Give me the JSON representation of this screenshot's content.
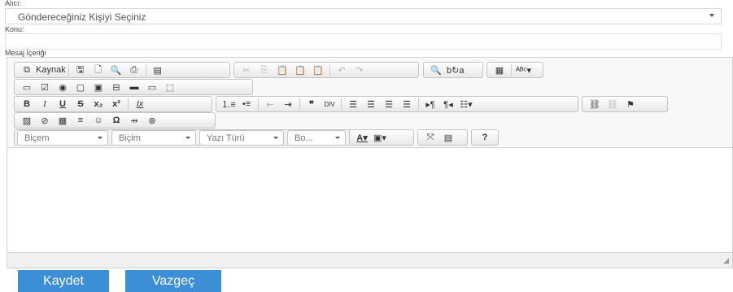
{
  "recipient": {
    "label": "Alıcı:",
    "placeholder": "Göndereceğiniz Kişiyi Seçiniz"
  },
  "subject": {
    "label": "Konu:",
    "value": ""
  },
  "message": {
    "label": "Mesaj İçeriği"
  },
  "toolbar": {
    "source_label": "Kaynak",
    "combos": {
      "styles": "Biçem",
      "format": "Biçim",
      "font": "Yazı Türü",
      "size": "Bo..."
    },
    "help": "?"
  },
  "actions": {
    "save": "Kaydet",
    "cancel": "Vazgeç"
  },
  "colors": {
    "button": "#3c8fd6"
  }
}
